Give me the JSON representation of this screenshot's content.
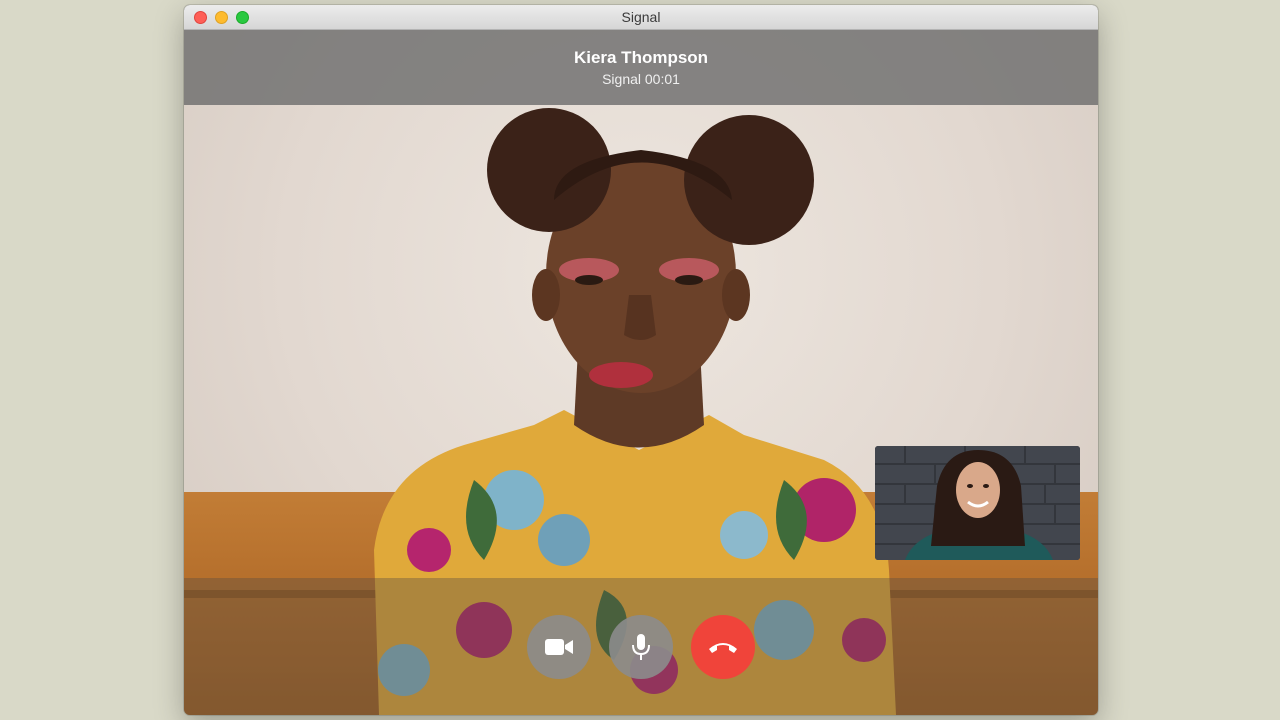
{
  "window": {
    "title": "Signal"
  },
  "call": {
    "contact_name": "Kiera Thompson",
    "status": "Signal 00:01"
  },
  "controls": {
    "video_icon": "video-camera-icon",
    "mic_icon": "microphone-icon",
    "hangup_icon": "phone-hangup-icon",
    "hangup_color": "#f0443a"
  },
  "colors": {
    "background": "#d9d9c8",
    "header_overlay": "#6e6e6e",
    "control_button": "#8c8c8c"
  }
}
